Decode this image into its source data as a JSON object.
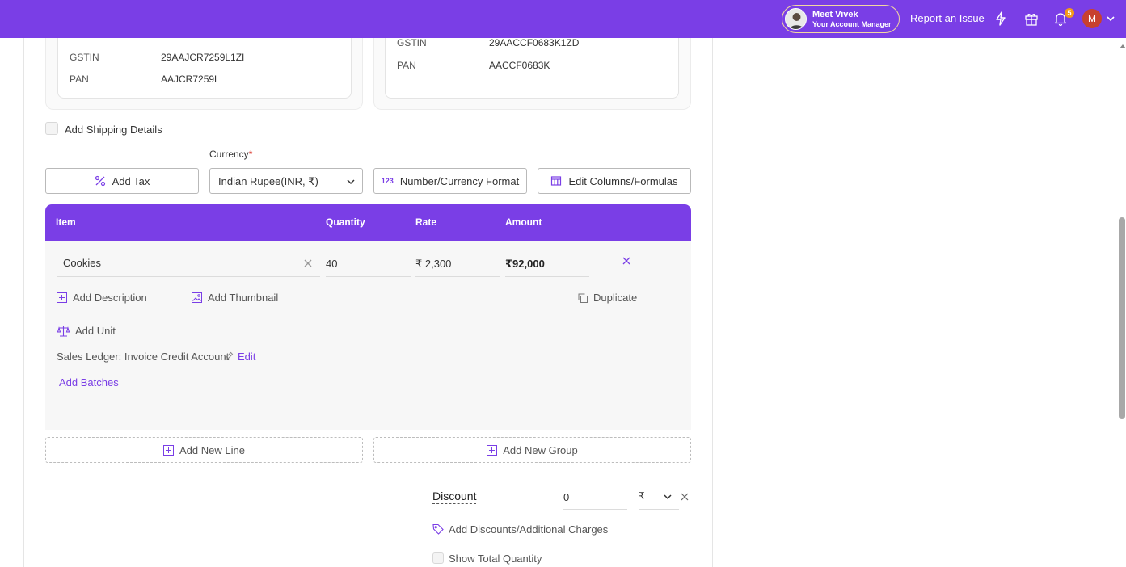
{
  "topbar": {
    "manager_title": "Meet Vivek",
    "manager_subtitle": "Your Account Manager",
    "report_issue": "Report an Issue",
    "notification_count": "5",
    "user_initial": "M"
  },
  "billed_by": {
    "gstin_label": "GSTIN",
    "gstin_value": "29AAJCR7259L1ZI",
    "pan_label": "PAN",
    "pan_value": "AAJCR7259L"
  },
  "billed_to": {
    "gstin_label": "GSTIN",
    "gstin_value": "29AACCF0683K1ZD",
    "pan_label": "PAN",
    "pan_value": "AACCF0683K"
  },
  "shipping": {
    "label": "Add Shipping Details",
    "checked": false
  },
  "currency": {
    "label": "Currency",
    "required_mark": "*",
    "value": "Indian Rupee(INR, ₹)"
  },
  "toolbar": {
    "add_tax": "Add Tax",
    "number_format_icon_text": "123",
    "number_format": "Number/Currency Format",
    "edit_columns": "Edit Columns/Formulas"
  },
  "table": {
    "headers": {
      "item": "Item",
      "quantity": "Quantity",
      "rate": "Rate",
      "amount": "Amount"
    },
    "row": {
      "item": "Cookies",
      "quantity": "40",
      "rate": "₹ 2,300",
      "amount": "₹92,000"
    },
    "actions": {
      "add_description": "Add Description",
      "add_thumbnail": "Add Thumbnail",
      "duplicate": "Duplicate",
      "add_unit": "Add Unit",
      "ledger_text": "Sales Ledger: Invoice Credit Account",
      "edit": "Edit",
      "add_batches": "Add Batches"
    }
  },
  "add_line": "Add New Line",
  "add_group": "Add New Group",
  "summary": {
    "discount_label": "Discount",
    "discount_value": "0",
    "discount_unit": "₹",
    "add_discounts": "Add Discounts/Additional Charges",
    "show_total_quantity": "Show Total Quantity"
  },
  "colors": {
    "brand": "#7a3ee6",
    "badge": "#f29a1a",
    "avatar": "#c8402e"
  }
}
